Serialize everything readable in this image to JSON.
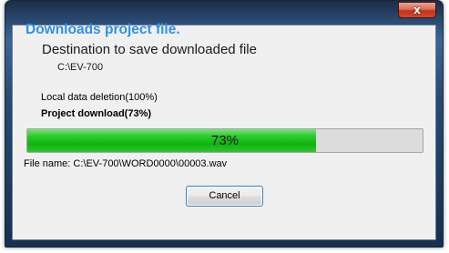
{
  "window": {
    "close_glyph": "x"
  },
  "dialog": {
    "heading": "Downloads project file.",
    "destination_label": "Destination to save downloaded file",
    "destination_path": "C:\\EV-700",
    "steps": [
      "Local data deletion(100%)",
      "Project download(73%)"
    ],
    "progress": {
      "percent": 73,
      "label": "73%"
    },
    "file_name_line": "File name: C:\\EV-700\\WORD0000\\00003.wav",
    "cancel_label": "Cancel"
  },
  "colors": {
    "heading": "#2f8fea",
    "progress_fill": "#0db40d",
    "close_button": "#c1331c"
  }
}
